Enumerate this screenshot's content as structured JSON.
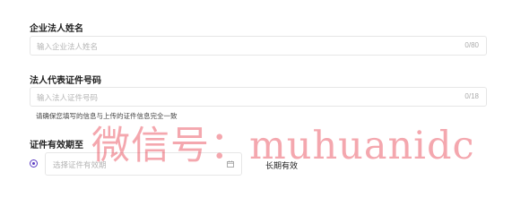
{
  "form": {
    "company_name_label": "企业法人姓名",
    "company_name_placeholder": "输入企业法人姓名",
    "company_name_count": "0/80",
    "id_number_label": "法人代表证件号码",
    "id_number_placeholder": "输入法人证件号码",
    "id_number_count": "0/18",
    "id_number_hint": "请确保您填写的信息与上传的证件信息完全一致",
    "validity_label": "证件有效期至",
    "validity_date_placeholder": "选择证件有效期",
    "validity_longterm_label": "长期有效"
  },
  "overlay": {
    "watermark_text": "微信号：muhuanidc"
  },
  "colors": {
    "accent": "#5b3cc4",
    "watermark": "#e63c4b"
  },
  "icons": {
    "calendar": "calendar-icon"
  }
}
